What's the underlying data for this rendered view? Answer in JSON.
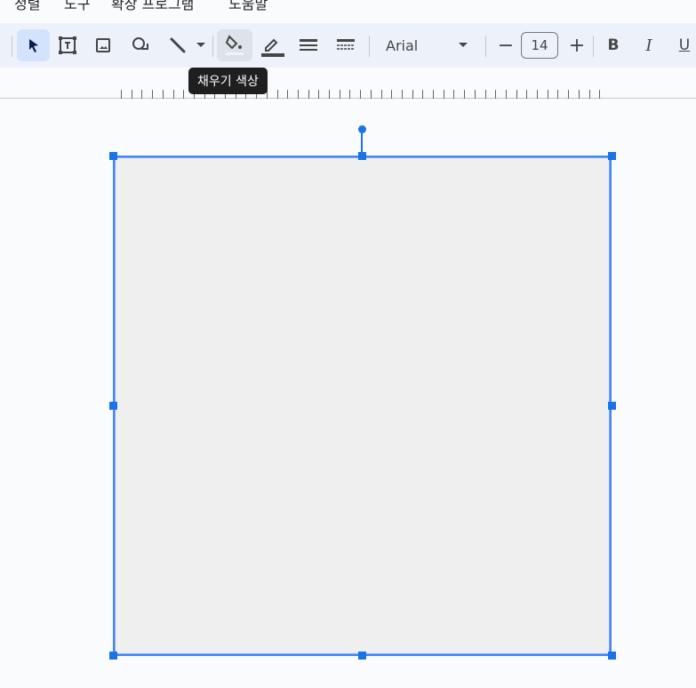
{
  "menu": [
    "정렬",
    "도구",
    "확장 프로그램",
    "도움말"
  ],
  "toolbar": {
    "font": "Arial",
    "font_size": "14",
    "bold": "B",
    "italic": "I",
    "underline": "U"
  },
  "tooltip": "채우기 색상",
  "colors": {
    "accent": "#1a73e8",
    "shape_fill": "#efefef",
    "toolbar_bg": "#edf2fa"
  }
}
